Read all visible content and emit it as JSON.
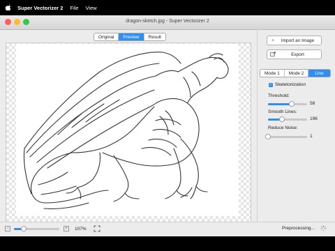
{
  "menubar": {
    "app": "Super Vectorizer 2",
    "menus": [
      "File",
      "View"
    ]
  },
  "window": {
    "title": "dragon-sketch.jpg - Super Vectorizer 2"
  },
  "view_tabs": {
    "items": [
      "Original",
      "Preview",
      "Result"
    ],
    "selected": "Preview"
  },
  "sidebar": {
    "import_label": "Import an Image",
    "export_label": "Export",
    "mode_tabs": {
      "items": [
        "Mode 1",
        "Mode 2",
        "Line"
      ],
      "selected": "Line"
    },
    "skeletonization": {
      "label": "Skeletonization",
      "checked": true
    },
    "threshold": {
      "label": "Threshold:",
      "value": "58",
      "level": 0.6
    },
    "smooth_lines": {
      "label": "Smooth Lines:",
      "value": "196",
      "level": 0.35
    },
    "reduce_noise": {
      "label": "Reduce Noise:",
      "value": "1",
      "level": 0.0
    }
  },
  "bottombar": {
    "zoom": "107%",
    "zoom_level": 0.22,
    "status": "Preprocessing..."
  },
  "colors": {
    "accent": "#2f8ef1",
    "close": "#fc5f57",
    "minimize": "#fdbc2e",
    "maximize": "#34c84a"
  },
  "icons": {
    "import": "plus-icon",
    "export": "export-box-icon",
    "fit": "fit-to-window-icon",
    "spinner": "progress-spinner-icon"
  }
}
